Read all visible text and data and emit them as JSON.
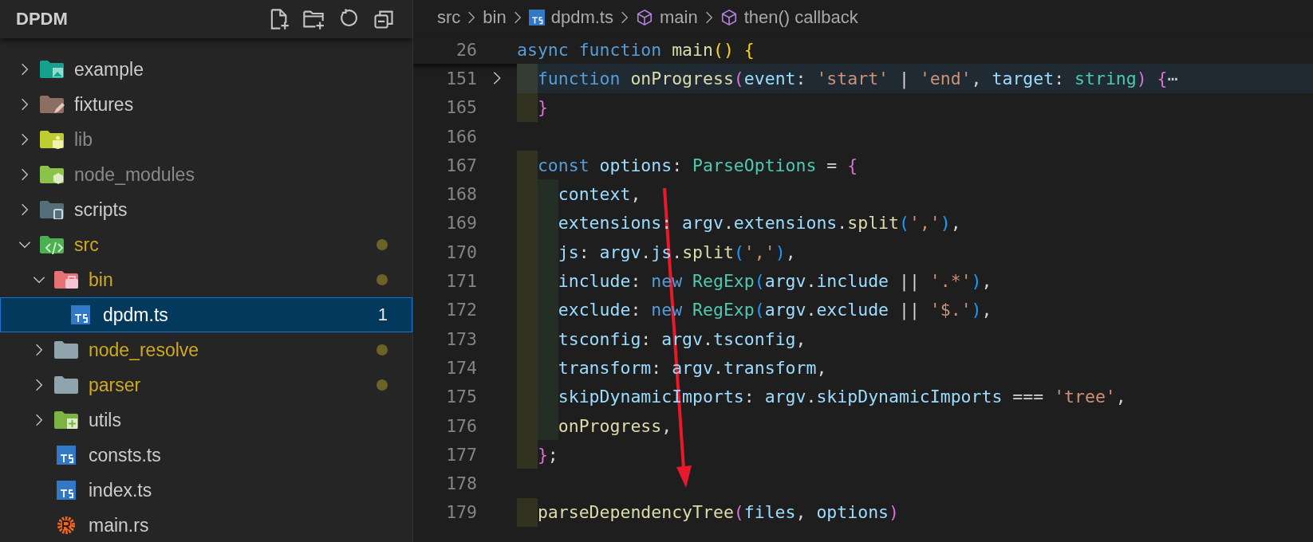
{
  "explorer": {
    "title": "DPDM",
    "tree": [
      {
        "label": "example",
        "kind": "folder-image",
        "expanded": false,
        "selected": false,
        "ignored": false,
        "modified": false
      },
      {
        "label": "fixtures",
        "kind": "folder-pen",
        "expanded": false,
        "selected": false,
        "ignored": false,
        "modified": false
      },
      {
        "label": "lib",
        "kind": "folder-lib",
        "expanded": false,
        "selected": false,
        "ignored": true,
        "modified": false
      },
      {
        "label": "node_modules",
        "kind": "folder-node",
        "expanded": false,
        "selected": false,
        "ignored": true,
        "modified": false
      },
      {
        "label": "scripts",
        "kind": "folder-scripts",
        "expanded": false,
        "selected": false,
        "ignored": false,
        "modified": false
      },
      {
        "label": "src",
        "kind": "folder-src",
        "expanded": true,
        "selected": false,
        "ignored": false,
        "modified": true,
        "children": [
          {
            "label": "bin",
            "kind": "folder-bin",
            "expanded": true,
            "selected": false,
            "ignored": false,
            "modified": true,
            "children": [
              {
                "label": "dpdm.ts",
                "kind": "ts",
                "selected": true,
                "ignored": false,
                "modified": false,
                "badge": "1"
              }
            ]
          },
          {
            "label": "node_resolve",
            "kind": "folder",
            "expanded": false,
            "selected": false,
            "ignored": false,
            "modified": true
          },
          {
            "label": "parser",
            "kind": "folder",
            "expanded": false,
            "selected": false,
            "ignored": false,
            "modified": true
          },
          {
            "label": "utils",
            "kind": "folder-utils",
            "expanded": false,
            "selected": false,
            "ignored": false,
            "modified": false
          },
          {
            "label": "consts.ts",
            "kind": "ts",
            "selected": false,
            "ignored": false,
            "modified": false
          },
          {
            "label": "index.ts",
            "kind": "ts",
            "selected": false,
            "ignored": false,
            "modified": false
          },
          {
            "label": "main.rs",
            "kind": "rust",
            "selected": false,
            "ignored": false,
            "modified": false
          }
        ]
      }
    ]
  },
  "editor": {
    "breadcrumb": [
      {
        "label": "src",
        "kind": "folder"
      },
      {
        "label": "bin",
        "kind": "folder"
      },
      {
        "label": "dpdm.ts",
        "kind": "ts"
      },
      {
        "label": "main",
        "kind": "symbol"
      },
      {
        "label": "then() callback",
        "kind": "symbol"
      }
    ],
    "sticky_line": {
      "number": "26",
      "tokens": [
        {
          "text": "async function ",
          "kind": "keyword"
        },
        {
          "text": "main",
          "kind": "function"
        },
        {
          "text": "() {",
          "kind": "bracket1"
        }
      ]
    },
    "lines": [
      {
        "number": "151",
        "folded": true,
        "highlighted": true,
        "tokens": [
          {
            "text": "  function ",
            "kind": "keyword"
          },
          {
            "text": "onProgress",
            "kind": "function"
          },
          {
            "text": "(",
            "kind": "bracket2"
          },
          {
            "text": "event",
            "kind": "variable"
          },
          {
            "text": ": ",
            "kind": "plain"
          },
          {
            "text": "'start'",
            "kind": "string"
          },
          {
            "text": " | ",
            "kind": "plain"
          },
          {
            "text": "'end'",
            "kind": "string"
          },
          {
            "text": ", ",
            "kind": "plain"
          },
          {
            "text": "target",
            "kind": "variable"
          },
          {
            "text": ": ",
            "kind": "plain"
          },
          {
            "text": "string",
            "kind": "type"
          },
          {
            "text": ") {",
            "kind": "bracket2"
          },
          {
            "text": "⋯",
            "kind": "fold"
          }
        ]
      },
      {
        "number": "165",
        "folded": false,
        "highlighted": false,
        "tokens": [
          {
            "text": "  }",
            "kind": "bracket2"
          }
        ]
      },
      {
        "number": "166",
        "folded": false,
        "highlighted": false
      },
      {
        "number": "167",
        "folded": false,
        "highlighted": false,
        "tokens": [
          {
            "text": "  const ",
            "kind": "keyword"
          },
          {
            "text": "options",
            "kind": "variable"
          },
          {
            "text": ": ",
            "kind": "plain"
          },
          {
            "text": "ParseOptions",
            "kind": "type"
          },
          {
            "text": " = ",
            "kind": "plain"
          },
          {
            "text": "{",
            "kind": "bracket2"
          }
        ]
      },
      {
        "number": "168",
        "folded": false,
        "highlighted": false,
        "tokens": [
          {
            "text": "    context",
            "kind": "variable"
          },
          {
            "text": ",",
            "kind": "plain"
          }
        ]
      },
      {
        "number": "169",
        "folded": false,
        "highlighted": false,
        "tokens": [
          {
            "text": "    extensions",
            "kind": "variable"
          },
          {
            "text": ": ",
            "kind": "plain"
          },
          {
            "text": "argv",
            "kind": "variable"
          },
          {
            "text": ".",
            "kind": "plain"
          },
          {
            "text": "extensions",
            "kind": "variable"
          },
          {
            "text": ".",
            "kind": "plain"
          },
          {
            "text": "split",
            "kind": "function"
          },
          {
            "text": "(",
            "kind": "bracket3"
          },
          {
            "text": "','",
            "kind": "string"
          },
          {
            "text": ")",
            "kind": "bracket3"
          },
          {
            "text": ",",
            "kind": "plain"
          }
        ]
      },
      {
        "number": "170",
        "folded": false,
        "highlighted": false,
        "tokens": [
          {
            "text": "    js",
            "kind": "variable"
          },
          {
            "text": ": ",
            "kind": "plain"
          },
          {
            "text": "argv",
            "kind": "variable"
          },
          {
            "text": ".",
            "kind": "plain"
          },
          {
            "text": "js",
            "kind": "variable"
          },
          {
            "text": ".",
            "kind": "plain"
          },
          {
            "text": "split",
            "kind": "function"
          },
          {
            "text": "(",
            "kind": "bracket3"
          },
          {
            "text": "','",
            "kind": "string"
          },
          {
            "text": ")",
            "kind": "bracket3"
          },
          {
            "text": ",",
            "kind": "plain"
          }
        ]
      },
      {
        "number": "171",
        "folded": false,
        "highlighted": false,
        "tokens": [
          {
            "text": "    include",
            "kind": "variable"
          },
          {
            "text": ": ",
            "kind": "plain"
          },
          {
            "text": "new ",
            "kind": "keyword"
          },
          {
            "text": "RegExp",
            "kind": "type"
          },
          {
            "text": "(",
            "kind": "bracket3"
          },
          {
            "text": "argv",
            "kind": "variable"
          },
          {
            "text": ".",
            "kind": "plain"
          },
          {
            "text": "include",
            "kind": "variable"
          },
          {
            "text": " || ",
            "kind": "plain"
          },
          {
            "text": "'.*'",
            "kind": "string"
          },
          {
            "text": ")",
            "kind": "bracket3"
          },
          {
            "text": ",",
            "kind": "plain"
          }
        ]
      },
      {
        "number": "172",
        "folded": false,
        "highlighted": false,
        "tokens": [
          {
            "text": "    exclude",
            "kind": "variable"
          },
          {
            "text": ": ",
            "kind": "plain"
          },
          {
            "text": "new ",
            "kind": "keyword"
          },
          {
            "text": "RegExp",
            "kind": "type"
          },
          {
            "text": "(",
            "kind": "bracket3"
          },
          {
            "text": "argv",
            "kind": "variable"
          },
          {
            "text": ".",
            "kind": "plain"
          },
          {
            "text": "exclude",
            "kind": "variable"
          },
          {
            "text": " || ",
            "kind": "plain"
          },
          {
            "text": "'$.'",
            "kind": "string"
          },
          {
            "text": ")",
            "kind": "bracket3"
          },
          {
            "text": ",",
            "kind": "plain"
          }
        ]
      },
      {
        "number": "173",
        "folded": false,
        "highlighted": false,
        "tokens": [
          {
            "text": "    tsconfig",
            "kind": "variable"
          },
          {
            "text": ": ",
            "kind": "plain"
          },
          {
            "text": "argv",
            "kind": "variable"
          },
          {
            "text": ".",
            "kind": "plain"
          },
          {
            "text": "tsconfig",
            "kind": "variable"
          },
          {
            "text": ",",
            "kind": "plain"
          }
        ]
      },
      {
        "number": "174",
        "folded": false,
        "highlighted": false,
        "tokens": [
          {
            "text": "    transform",
            "kind": "variable"
          },
          {
            "text": ": ",
            "kind": "plain"
          },
          {
            "text": "argv",
            "kind": "variable"
          },
          {
            "text": ".",
            "kind": "plain"
          },
          {
            "text": "transform",
            "kind": "variable"
          },
          {
            "text": ",",
            "kind": "plain"
          }
        ]
      },
      {
        "number": "175",
        "folded": false,
        "highlighted": false,
        "tokens": [
          {
            "text": "    skipDynamicImports",
            "kind": "variable"
          },
          {
            "text": ": ",
            "kind": "plain"
          },
          {
            "text": "argv",
            "kind": "variable"
          },
          {
            "text": ".",
            "kind": "plain"
          },
          {
            "text": "skipDynamicImports",
            "kind": "variable"
          },
          {
            "text": " === ",
            "kind": "plain"
          },
          {
            "text": "'tree'",
            "kind": "string"
          },
          {
            "text": ",",
            "kind": "plain"
          }
        ]
      },
      {
        "number": "176",
        "folded": false,
        "highlighted": false,
        "tokens": [
          {
            "text": "    onProgress",
            "kind": "function"
          },
          {
            "text": ",",
            "kind": "plain"
          }
        ]
      },
      {
        "number": "177",
        "folded": false,
        "highlighted": false,
        "tokens": [
          {
            "text": "  }",
            "kind": "bracket2"
          },
          {
            "text": ";",
            "kind": "plain"
          }
        ]
      },
      {
        "number": "178",
        "folded": false,
        "highlighted": false
      },
      {
        "number": "179",
        "folded": false,
        "highlighted": false,
        "tokens": [
          {
            "text": "  parseDependencyTree",
            "kind": "function"
          },
          {
            "text": "(",
            "kind": "bracket2"
          },
          {
            "text": "files",
            "kind": "variable"
          },
          {
            "text": ", ",
            "kind": "plain"
          },
          {
            "text": "options",
            "kind": "variable"
          },
          {
            "text": ")",
            "kind": "bracket2"
          }
        ]
      }
    ]
  }
}
